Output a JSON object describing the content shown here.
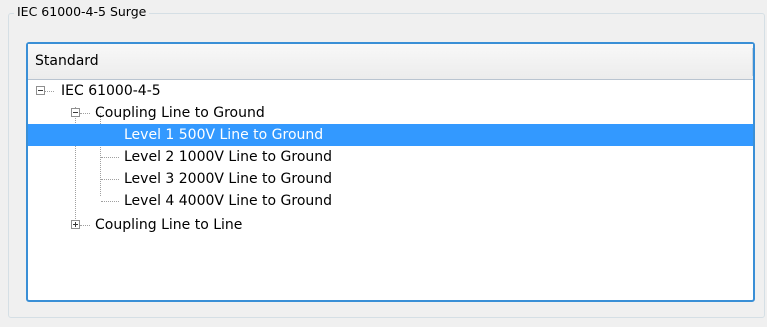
{
  "groupbox": {
    "title": "IEC 61000-4-5 Surge"
  },
  "tree": {
    "header": "Standard",
    "root": {
      "label": "IEC 61000-4-5",
      "expanded": true
    },
    "group1": {
      "label": "Coupling Line to Ground",
      "expanded": true
    },
    "items": [
      {
        "label": "Level 1 500V Line to Ground",
        "selected": true
      },
      {
        "label": "Level 2 1000V Line to Ground",
        "selected": false
      },
      {
        "label": "Level 3 2000V Line to Ground",
        "selected": false
      },
      {
        "label": "Level 4 4000V Line to Ground",
        "selected": false
      }
    ],
    "group2": {
      "label": "Coupling Line to Line",
      "expanded": false
    }
  },
  "colors": {
    "selection": "#3399ff",
    "focus_border": "#3a8fd6"
  }
}
